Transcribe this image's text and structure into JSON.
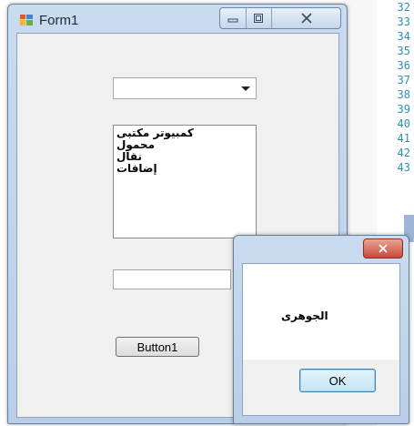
{
  "editor": {
    "line_numbers": [
      "32",
      "33",
      "34",
      "35",
      "36",
      "37",
      "38",
      "39",
      "40",
      "41",
      "42",
      "43"
    ]
  },
  "form": {
    "title": "Form1",
    "icon": "form-app-icon",
    "caption_buttons": {
      "minimize": "minimize-icon",
      "maximize": "maximize-icon",
      "close": "close-icon"
    },
    "combobox": {
      "value": ""
    },
    "listbox": {
      "items": [
        "كمبيوتر مكتبى",
        "محمول",
        "نقال",
        "إضافات"
      ]
    },
    "textbox": {
      "value": ""
    },
    "button1_label": "Button1"
  },
  "messagebox": {
    "text": "الجوهرى",
    "ok_label": "OK",
    "close_icon": "close-icon"
  },
  "colors": {
    "window_frame": "#c9dbef",
    "close_button": "#c9493a",
    "ok_button_border": "#3c7fb1"
  }
}
